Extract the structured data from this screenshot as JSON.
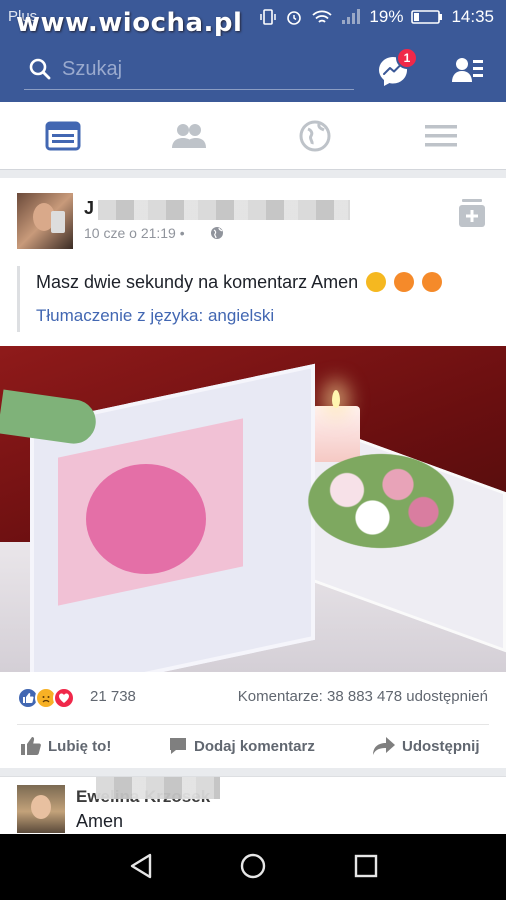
{
  "status_bar": {
    "carrier": "Plus",
    "watermark": "www.wiocha.pl",
    "battery": "19%",
    "time": "14:35"
  },
  "header": {
    "search_placeholder": "Szukaj",
    "messenger_badge": "1"
  },
  "tabs": [
    "news-feed",
    "friends",
    "globe",
    "menu"
  ],
  "post": {
    "author_initial": "J",
    "timestamp": "10 cze o 21:19 •",
    "text": "Masz dwie sekundy na komentarz Amen",
    "translate_link": "Tłumaczenie z języka: angielski",
    "reaction_count": "21 738",
    "comments_shares": "Komentarze: 38 883  478 udostępnień",
    "actions": {
      "like": "Lubię to!",
      "comment": "Dodaj komentarz",
      "share": "Udostępnij"
    }
  },
  "comment": {
    "name": "Ewelina Krzosek",
    "text": "Amen"
  },
  "colors": {
    "brand": "#3b5998",
    "link": "#4267b2",
    "badge": "#f02849"
  }
}
